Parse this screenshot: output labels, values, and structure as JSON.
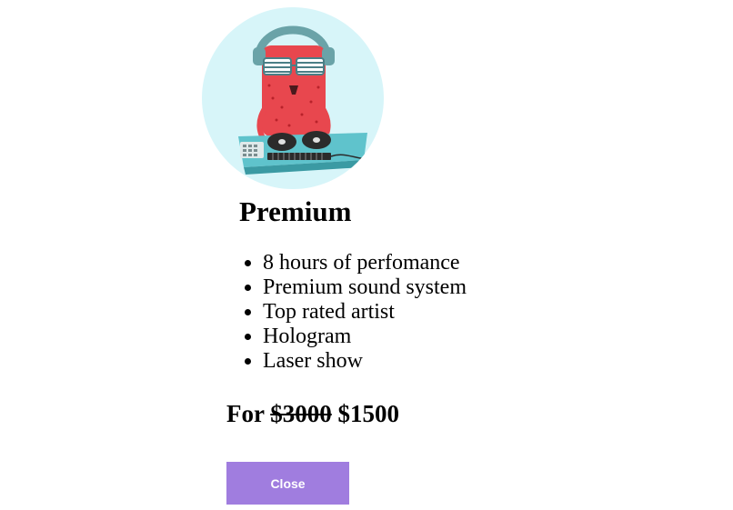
{
  "plan": {
    "title": "Premium",
    "features": [
      "8 hours of perfomance",
      "Premium sound system",
      "Top rated artist",
      "Hologram",
      "Laser show"
    ],
    "price_prefix": "For",
    "old_price": "$3000",
    "new_price": "$1500"
  },
  "buttons": {
    "close_label": "Close"
  },
  "colors": {
    "avatar_background": "#d7f5f9",
    "button_background": "#a07ddf",
    "button_text": "#ffffff",
    "character_body": "#e8474e",
    "turntable": "#5fc3cc"
  },
  "image": {
    "subject": "dj-monster-illustration"
  }
}
